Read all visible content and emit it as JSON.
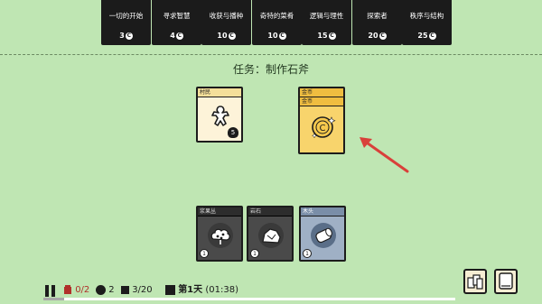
{
  "shop": {
    "packs": [
      {
        "name": "一切的开始",
        "cost": "3"
      },
      {
        "name": "寻求智慧",
        "cost": "4"
      },
      {
        "name": "收获与播种",
        "cost": "10"
      },
      {
        "name": "奇特的菜肴",
        "cost": "10"
      },
      {
        "name": "逻辑与理性",
        "cost": "15"
      },
      {
        "name": "探索者",
        "cost": "20"
      },
      {
        "name": "秩序与结构",
        "cost": "25"
      }
    ],
    "coin_glyph": "C"
  },
  "quest": {
    "text": "任务：制作石斧"
  },
  "cards": {
    "villager": {
      "title": "村民",
      "health": "5",
      "icon": "villager-icon"
    },
    "gold": {
      "title_back": "金币",
      "title_front": "金币",
      "glyph": "C",
      "icon": "coin-icon"
    },
    "berry_bush": {
      "title": "浆果丛",
      "count": "1",
      "icon": "bush-icon"
    },
    "rock": {
      "title": "岩石",
      "count": "1",
      "icon": "rock-icon"
    },
    "wood": {
      "title": "木头",
      "count": "1",
      "icon": "log-icon"
    }
  },
  "status": {
    "food": "0/2",
    "coins": "2",
    "cards": "3/20",
    "day": "第1天",
    "time": "(01:38)",
    "day_progress": 0.05,
    "accent_red": "#b0302a"
  }
}
